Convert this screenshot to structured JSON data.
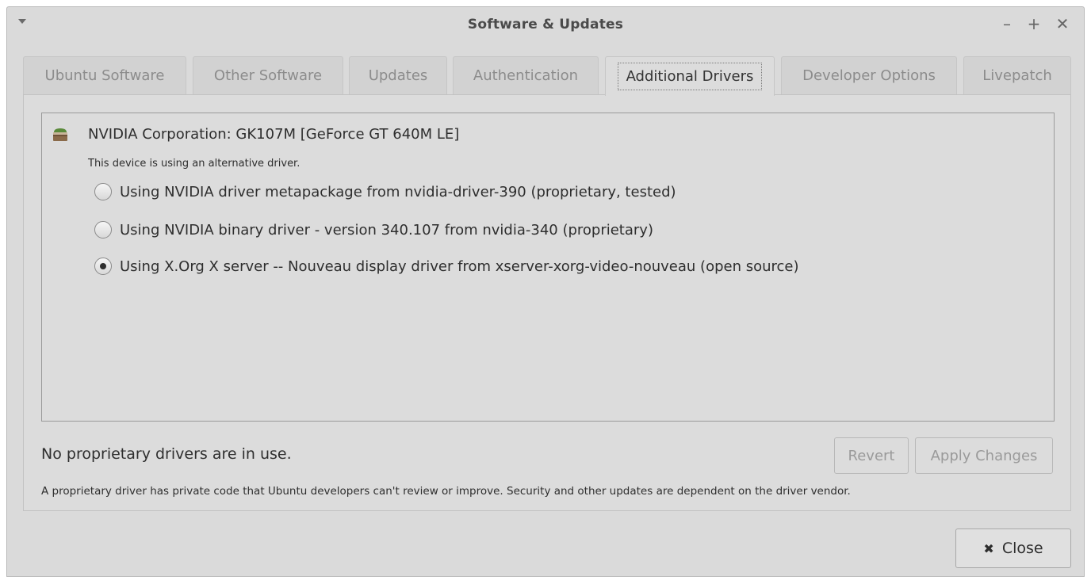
{
  "window": {
    "title": "Software & Updates",
    "controls": {
      "minimize": "–",
      "maximize": "+",
      "close": "✕"
    }
  },
  "tabs": [
    {
      "label": "Ubuntu Software",
      "active": false
    },
    {
      "label": "Other Software",
      "active": false
    },
    {
      "label": "Updates",
      "active": false
    },
    {
      "label": "Authentication",
      "active": false
    },
    {
      "label": "Additional Drivers",
      "active": true
    },
    {
      "label": "Developer Options",
      "active": false
    },
    {
      "label": "Livepatch",
      "active": false
    }
  ],
  "device": {
    "icon": "graphics-card-icon",
    "name": "NVIDIA Corporation: GK107M [GeForce GT 640M LE]",
    "status": "This device is using an alternative driver.",
    "drivers": [
      {
        "label": "Using NVIDIA driver metapackage from nvidia-driver-390 (proprietary, tested)",
        "selected": false
      },
      {
        "label": "Using NVIDIA binary driver - version 340.107 from nvidia-340 (proprietary)",
        "selected": false
      },
      {
        "label": "Using X.Org X server -- Nouveau display driver from xserver-xorg-video-nouveau (open source)",
        "selected": true
      }
    ]
  },
  "footer": {
    "status": "No proprietary drivers are in use.",
    "revert_label": "Revert",
    "apply_label": "Apply Changes",
    "note": "A proprietary driver has private code that Ubuntu developers can't review or improve. Security and other updates are dependent on the driver vendor."
  },
  "close_button": {
    "label": "Close",
    "icon": "close-x-icon"
  }
}
